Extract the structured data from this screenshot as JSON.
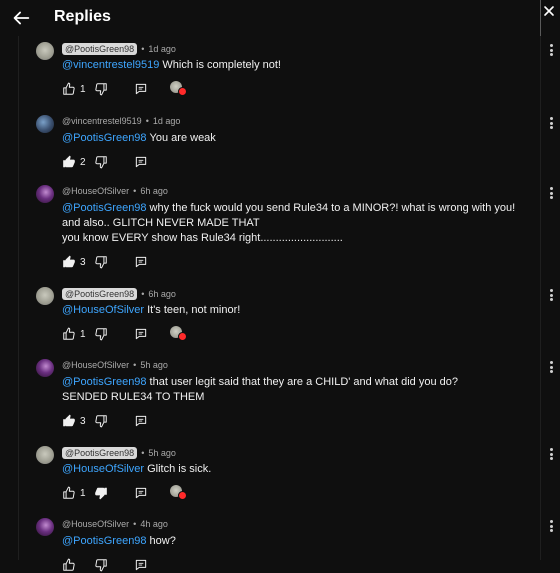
{
  "header": {
    "title": "Replies"
  },
  "comments": [
    {
      "author": "@PootisGreen98",
      "chip": true,
      "time": "1d ago",
      "mention": "@vincentrestel9519",
      "text": "Which is completely not!",
      "lines": [],
      "likes": "1",
      "liked": false,
      "avatar": "pootis"
    },
    {
      "author": "@vincentrestel9519",
      "chip": false,
      "time": "1d ago",
      "mention": "@PootisGreen98",
      "text": "You are weak",
      "lines": [],
      "likes": "2",
      "liked": true,
      "avatar": "vincent"
    },
    {
      "author": "@HouseOfSilver",
      "chip": false,
      "time": "6h ago",
      "mention": "@PootisGreen98",
      "text": "why the fuck would you send Rule34 to a MINOR?! what is wrong with you!",
      "lines": [
        "and also.. GLITCH NEVER MADE THAT",
        "you know EVERY show has Rule34 right..........................."
      ],
      "likes": "3",
      "liked": true,
      "avatar": "house"
    },
    {
      "author": "@PootisGreen98",
      "chip": true,
      "time": "6h ago",
      "mention": "@HouseOfSilver",
      "text": "It's teen, not minor!",
      "lines": [],
      "likes": "1",
      "liked": false,
      "avatar": "pootis"
    },
    {
      "author": "@HouseOfSilver",
      "chip": false,
      "time": "5h ago",
      "mention": "@PootisGreen98",
      "text": "that user legit said that they are a CHILD' and what did you do?",
      "lines": [
        "SENDED RULE34 TO THEM"
      ],
      "likes": "3",
      "liked": true,
      "avatar": "house"
    },
    {
      "author": "@PootisGreen98",
      "chip": true,
      "time": "5h ago",
      "mention": "@HouseOfSilver",
      "text": "Glitch is sick.",
      "lines": [],
      "likes": "1",
      "liked": false,
      "avatar": "pootis"
    },
    {
      "author": "@HouseOfSilver",
      "chip": false,
      "time": "4h ago",
      "mention": "@PootisGreen98",
      "text": "how?",
      "lines": [],
      "likes": "",
      "liked": false,
      "avatar": "house"
    }
  ],
  "icons": {
    "back": "arrow-left-icon",
    "like": "thumbs-up-icon",
    "dislike": "thumbs-down-icon",
    "reply": "reply-icon",
    "more": "more-vertical-icon",
    "creator_heart": "creator-heart-icon"
  }
}
